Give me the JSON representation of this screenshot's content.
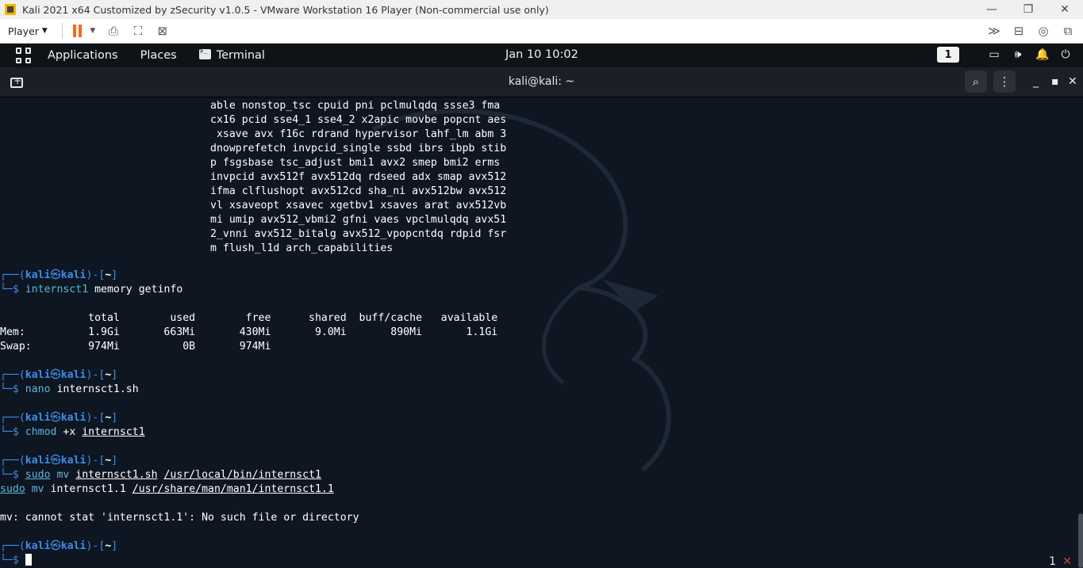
{
  "vmware": {
    "title": "Kali 2021 x64 Customized by zSecurity v1.0.5 - VMware Workstation 16 Player (Non-commercial use only)",
    "player_label": "Player",
    "minimize": "—",
    "restore": "❐",
    "close": "✕"
  },
  "topbar": {
    "applications": "Applications",
    "places": "Places",
    "terminal": "Terminal",
    "clock": "Jan 10  10:02",
    "workspace": "1"
  },
  "terminal": {
    "title": "kali@kali: ~",
    "cpu_flags": [
      "able nonstop_tsc cpuid pni pclmulqdq ssse3 fma",
      "cx16 pcid sse4_1 sse4_2 x2apic movbe popcnt aes",
      " xsave avx f16c rdrand hypervisor lahf_lm abm 3",
      "dnowprefetch invpcid_single ssbd ibrs ibpb stib",
      "p fsgsbase tsc_adjust bmi1 avx2 smep bmi2 erms",
      "invpcid avx512f avx512dq rdseed adx smap avx512",
      "ifma clflushopt avx512cd sha_ni avx512bw avx512",
      "vl xsaveopt xsavec xgetbv1 xsaves arat avx512vb",
      "mi umip avx512_vbmi2 gfni vaes vpclmulqdq avx51",
      "2_vnni avx512_bitalg avx512_vpopcntdq rdpid fsr",
      "m flush_l1d arch_capabilities"
    ],
    "prompt_top": "┌──(kali㉿kali)-[~]",
    "prompt_user": "kali",
    "prompt_host": "kali",
    "prompt_dir": "~",
    "memory_header": "              total        used        free      shared  buff/cache   available",
    "memory_mem": "Mem:          1.9Gi       663Mi       430Mi       9.0Mi       890Mi       1.1Gi",
    "memory_swap": "Swap:         974Mi          0B       974Mi",
    "cmd1_name": "internsct1",
    "cmd1_args": " memory getinfo",
    "cmd2_name": "nano",
    "cmd2_args": " internsct1.sh",
    "cmd3_name": "chmod",
    "cmd3_args": " +x ",
    "cmd3_file": "internsct1",
    "cmd4_sudo": "sudo",
    "cmd4_mv": " mv ",
    "cmd4_src": "internsct1.sh",
    "cmd4_dst": "/usr/local/bin/internsct1",
    "cmd4b_sudo": "sudo",
    "cmd4b_mv": " mv ",
    "cmd4b_src": "internsct1.1 ",
    "cmd4b_dst": "/usr/share/man/man1/internsct1.1",
    "error": "mv: cannot stat 'internsct1.1': No such file or directory",
    "status_number": "1",
    "status_x": "✕"
  },
  "colors": {
    "prompt_blue": "#3b8eea",
    "command_teal": "#5fb6d8",
    "pause_orange": "#f26b1d"
  }
}
